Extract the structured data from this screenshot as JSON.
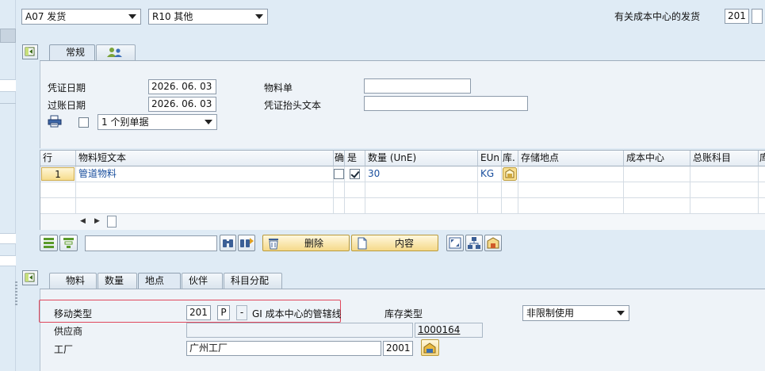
{
  "header": {
    "transaction_combo": "A07 发货",
    "reference_combo": "R10 其他",
    "movement_label": "有关成本中心的发货",
    "movement_code": "201"
  },
  "general_tab": {
    "tabs": [
      {
        "label": "常规"
      },
      {
        "label": ""
      }
    ],
    "doc_date_label": "凭证日期",
    "doc_date_value": "2026. 06. 03",
    "posting_date_label": "过账日期",
    "posting_date_value": "2026. 06. 03",
    "material_slip_label": "物料单",
    "material_slip_value": "",
    "header_text_label": "凭证抬头文本",
    "header_text_value": "",
    "print_option": "1 个别单据"
  },
  "items_table": {
    "columns": [
      "行",
      "物料短文本",
      "确",
      "是",
      "数量 (UnE)",
      "EUn",
      "库.",
      "存储地点",
      "成本中心",
      "总账科目",
      "库"
    ],
    "rows": [
      {
        "line": "1",
        "material_text": "管道物料",
        "ok": false,
        "is": true,
        "qty": "30",
        "unit": "KG"
      }
    ]
  },
  "toolbar": {
    "delete_label": "删除",
    "content_label": "内容"
  },
  "detail_tabs": [
    {
      "label": "物料"
    },
    {
      "label": "数量"
    },
    {
      "label": "地点"
    },
    {
      "label": "伙伴"
    },
    {
      "label": "科目分配"
    }
  ],
  "detail": {
    "movement_type_label": "移动类型",
    "movement_type_value": "201",
    "movement_indicator": "P",
    "movement_dash": "-",
    "movement_desc": "GI 成本中心的管辖线",
    "stock_type_label": "库存类型",
    "stock_type_value": "非限制使用",
    "vendor_label": "供应商",
    "vendor_value": "",
    "vendor_code": "1000164",
    "plant_label": "工厂",
    "plant_name": "广州工厂",
    "plant_code": "2001"
  },
  "colors": {
    "background": "#dfebf5",
    "highlight": "#e0475c",
    "link": "#1a4f9e"
  }
}
